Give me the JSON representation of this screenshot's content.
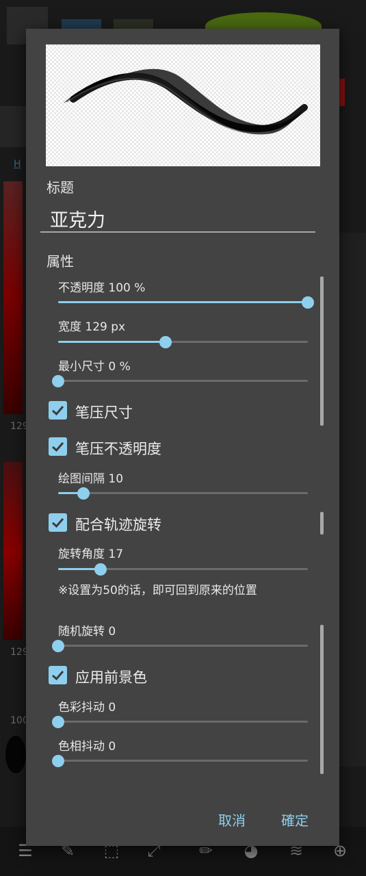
{
  "background": {
    "tab_label": "H",
    "side_values": [
      "129",
      "129",
      "100"
    ]
  },
  "dialog": {
    "title_label": "标题",
    "title_value": "亚克力",
    "properties_label": "属性",
    "sliders": {
      "opacity": {
        "label": "不透明度 100 %",
        "value": 1.0
      },
      "width": {
        "label": "宽度 129 px",
        "value": 0.43
      },
      "min_size": {
        "label": "最小尺寸  0  %",
        "value": 0.0
      },
      "spacing": {
        "label": "绘图间隔 10",
        "value": 0.1
      },
      "rotation_angle": {
        "label": "旋转角度 17",
        "value": 0.17
      },
      "random_rotation": {
        "label": "随机旋转  0",
        "value": 0.0
      },
      "color_jitter": {
        "label": "色彩抖动  0",
        "value": 0.0
      },
      "hue_jitter": {
        "label": "色相抖动  0",
        "value": 0.0
      }
    },
    "checkboxes": {
      "pressure_size": {
        "label": "笔压尺寸",
        "checked": true
      },
      "pressure_opacity": {
        "label": "笔压不透明度",
        "checked": true
      },
      "follow_rotation": {
        "label": "配合轨迹旋转",
        "checked": true
      },
      "apply_foreground": {
        "label": "应用前景色",
        "checked": true
      }
    },
    "rotation_note": "※设置为50的话，即可回到原来的位置",
    "cancel_label": "取消",
    "confirm_label": "確定"
  },
  "colors": {
    "accent": "#8ecfee",
    "dialog_bg": "#434343"
  }
}
